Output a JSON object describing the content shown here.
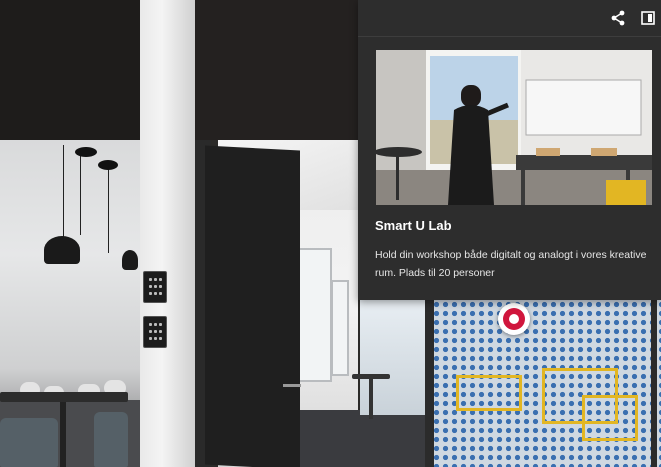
{
  "viewer": {
    "toolbar": {
      "share_icon": "share-icon",
      "expand_icon": "collapse-panel-icon"
    }
  },
  "tag": {
    "title": "Smart U Lab",
    "description": "Hold din workshop både digitalt og analogt i vores kreative rum. Plads til 20 personer",
    "media_icon": "photo-image",
    "accent_color": "#d0163d"
  },
  "hotspot": {
    "icon": "tag-pin-icon",
    "color": "#d0163d"
  }
}
